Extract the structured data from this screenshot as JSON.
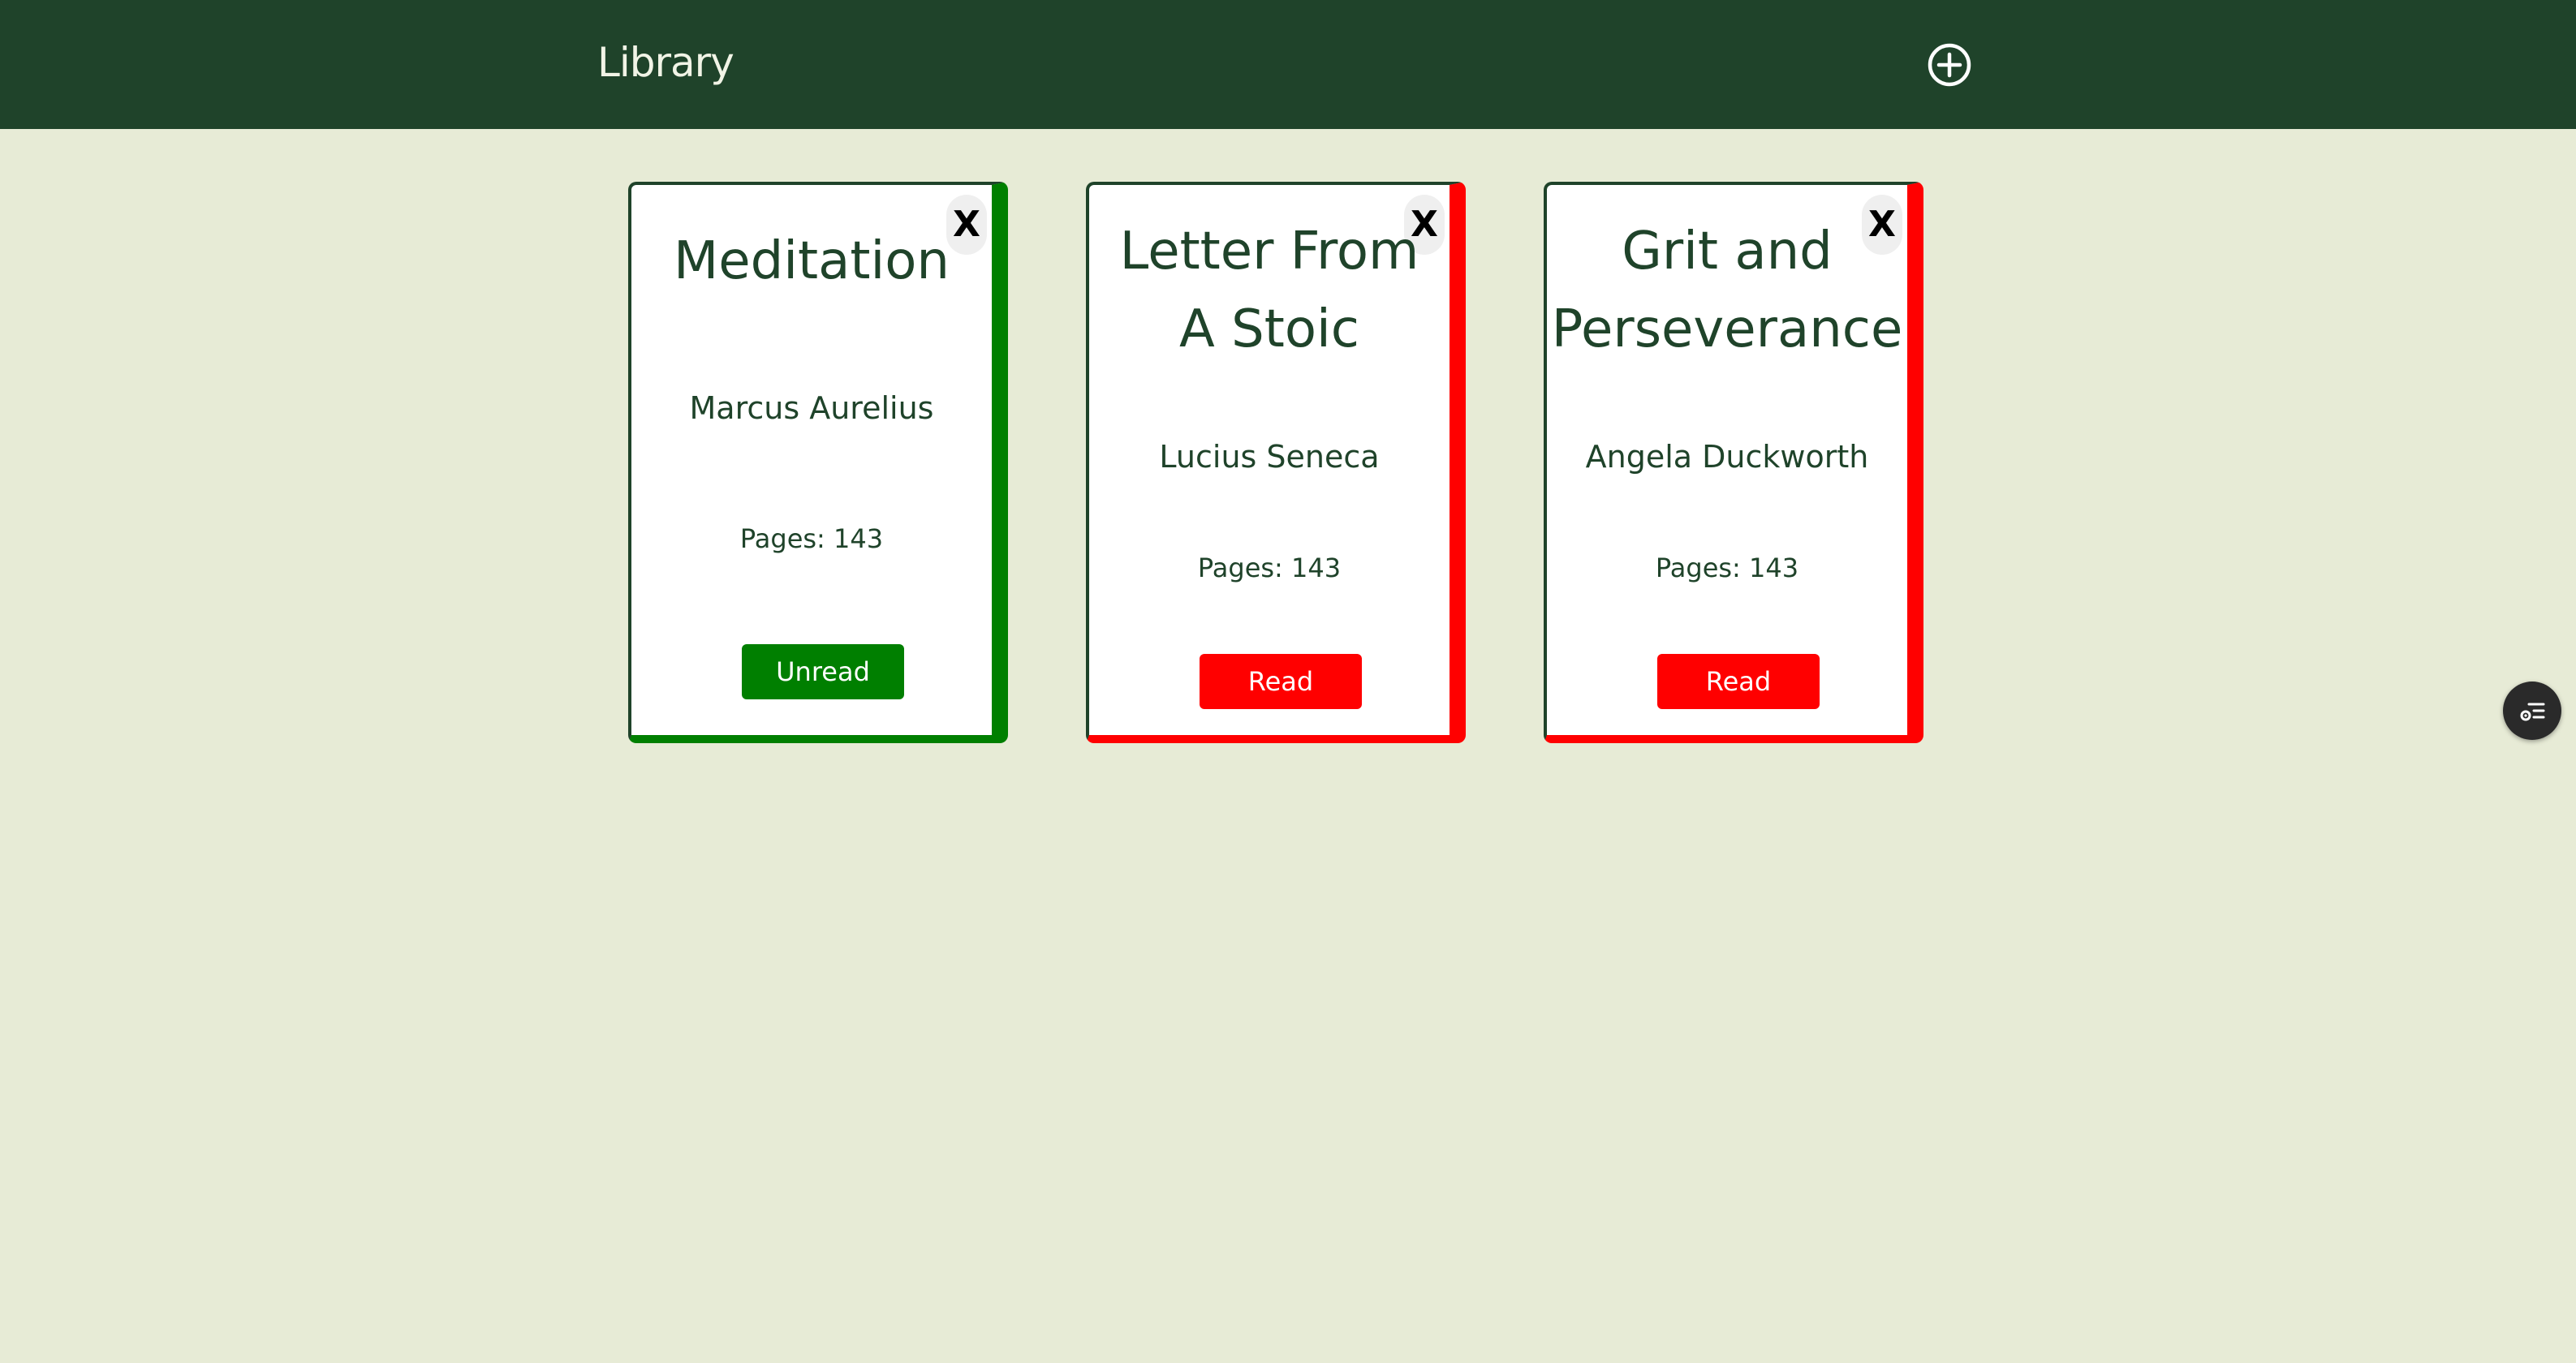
{
  "header": {
    "title": "Library",
    "add_icon": "plus-circle-icon"
  },
  "books": [
    {
      "title_lines": [
        "Meditation"
      ],
      "author": "Marcus Aurelius",
      "pages_text": "Pages: 143",
      "status_label": "Unread",
      "close_label": "X",
      "accent_color": "#007f00"
    },
    {
      "title_lines": [
        "Letter From",
        "A Stoic"
      ],
      "author": "Lucius Seneca",
      "pages_text": "Pages: 143",
      "status_label": "Read",
      "close_label": "X",
      "accent_color": "#ff0000"
    },
    {
      "title_lines": [
        "Grit and",
        "Perseverance"
      ],
      "author": "Angela Duckworth",
      "pages_text": "Pages: 143",
      "status_label": "Read",
      "close_label": "X",
      "accent_color": "#ff0000"
    }
  ],
  "colors": {
    "header_bg": "#1f432a",
    "page_bg": "#e7ebd6",
    "unread": "#007f00",
    "read": "#ff0000"
  },
  "floating_button_icon": "settings-list-icon"
}
